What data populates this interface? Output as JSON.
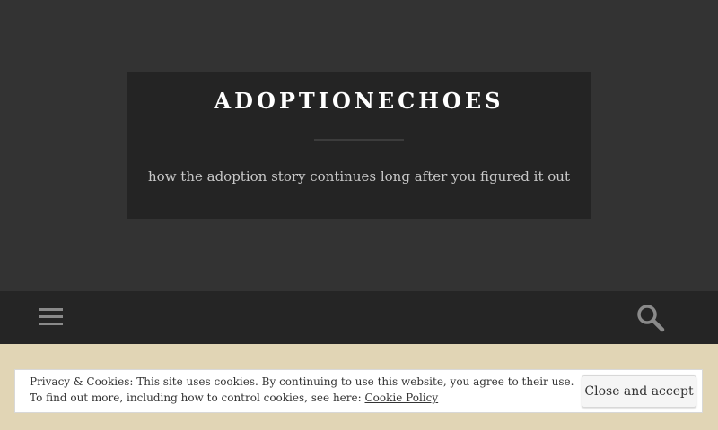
{
  "site": {
    "title": "ADOPTIONECHOES",
    "tagline": "how the adoption story continues long after you figured it out"
  },
  "nav": {
    "menu_icon": "hamburger-menu-icon",
    "search_icon": "search-icon"
  },
  "cookie_banner": {
    "line1": "Privacy & Cookies: This site uses cookies. By continuing to use this website, you agree to their use.",
    "line2_prefix": "To find out more, including how to control cookies, see here: ",
    "policy_link": "Cookie Policy",
    "close_button": "Close and accept"
  },
  "colors": {
    "header_bg": "#333333",
    "title_box_bg": "#242424",
    "navbar_bg": "#252525",
    "banner_bg": "#e1d5b5",
    "icon_gray": "#8a8a8a"
  }
}
